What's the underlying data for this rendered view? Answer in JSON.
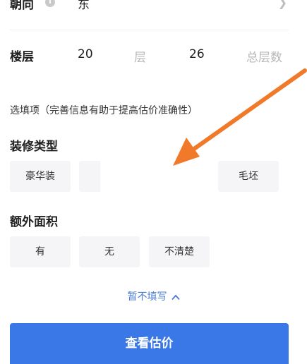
{
  "orientation": {
    "label": "朝向",
    "info_icon": "info-icon",
    "value": "东",
    "chevron_icon": "chevron-right-icon"
  },
  "floor": {
    "label": "楼层",
    "value": "20",
    "unit": "层",
    "total_value": "26",
    "total_label": "总层数"
  },
  "optional_note": "选填项（完善信息有助于提高估价准确性）",
  "decoration": {
    "title": "装修类型",
    "options": [
      "豪华装",
      "毛坯"
    ]
  },
  "extra_area": {
    "title": "额外面积",
    "options": [
      "有",
      "无",
      "不清楚"
    ]
  },
  "collapse": {
    "label": "暂不填写",
    "icon": "chevron-up-icon"
  },
  "cta": {
    "label": "查看估价"
  },
  "colors": {
    "accent": "#3b78e7",
    "link": "#4a7bd0",
    "arrow": "#f07a2a"
  }
}
